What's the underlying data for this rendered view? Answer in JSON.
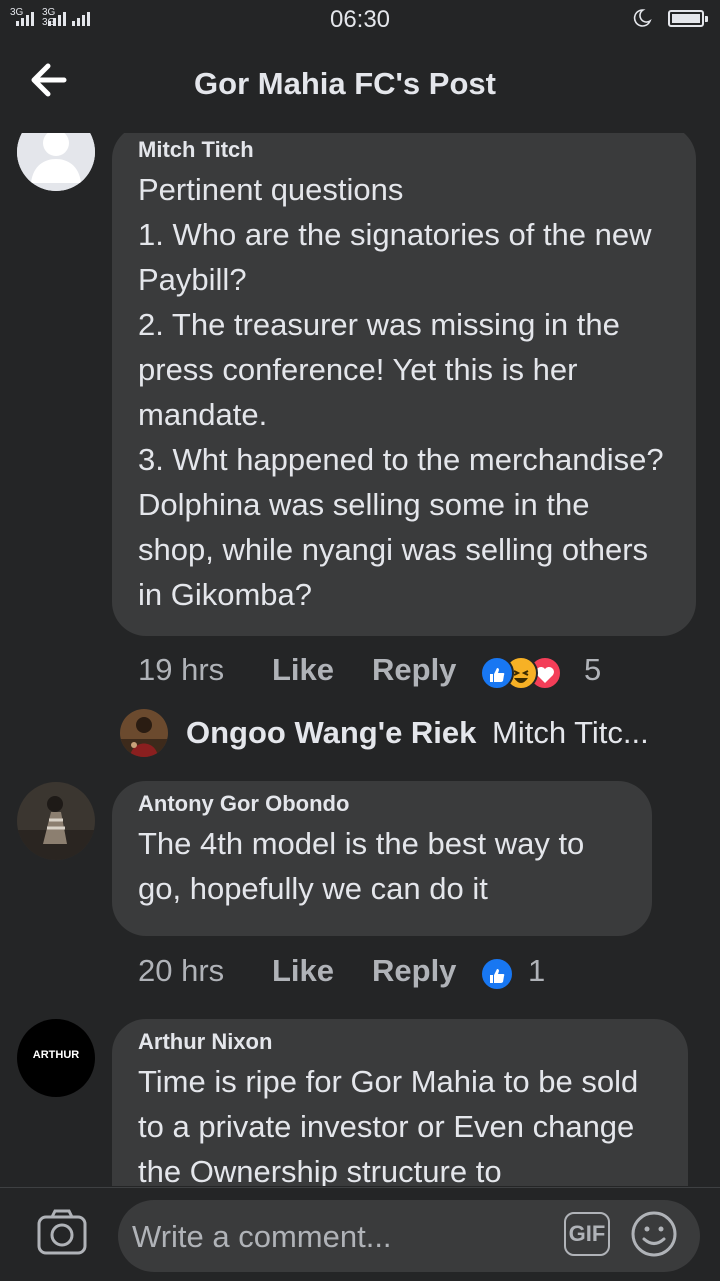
{
  "status_bar": {
    "network1": "3G",
    "network2": "3G 3G",
    "time": "06:30"
  },
  "header": {
    "title": "Gor Mahia FC's Post"
  },
  "comments": [
    {
      "author": "Mitch Titch",
      "text": "Pertinent questions\n1. Who are the signatories of the new Paybill?\n2. The treasurer was missing in the press conference! Yet this is her mandate.\n3. Wht happened to the merchandise? Dolphina was selling some in the shop, while nyangi was selling others in Gikomba?",
      "time": "19 hrs",
      "like": "Like",
      "reply": "Reply",
      "reaction_count": "5",
      "reactions": [
        "like-icon",
        "haha-icon",
        "love-icon"
      ]
    },
    {
      "author": "Antony Gor Obondo",
      "text": "The 4th model is the best way to go, hopefully we can do it",
      "time": "20 hrs",
      "like": "Like",
      "reply": "Reply",
      "reaction_count": "1",
      "reactions": [
        "like-icon"
      ]
    },
    {
      "author": "Arthur Nixon",
      "avatar_text": "ARTHUR",
      "text": "Time is ripe for Gor Mahia to be sold to a private investor or Even change the Ownership structure to"
    }
  ],
  "reply_preview": {
    "name": "Ongoo Wang'e Riek",
    "text": "Mitch Titc..."
  },
  "footer": {
    "placeholder": "Write a comment...",
    "gif": "GIF"
  },
  "colors": {
    "background": "#242526",
    "bubble": "#3a3b3c",
    "like_blue": "#1877f2",
    "love_red": "#f33e58",
    "haha_yellow": "#f7b125"
  }
}
